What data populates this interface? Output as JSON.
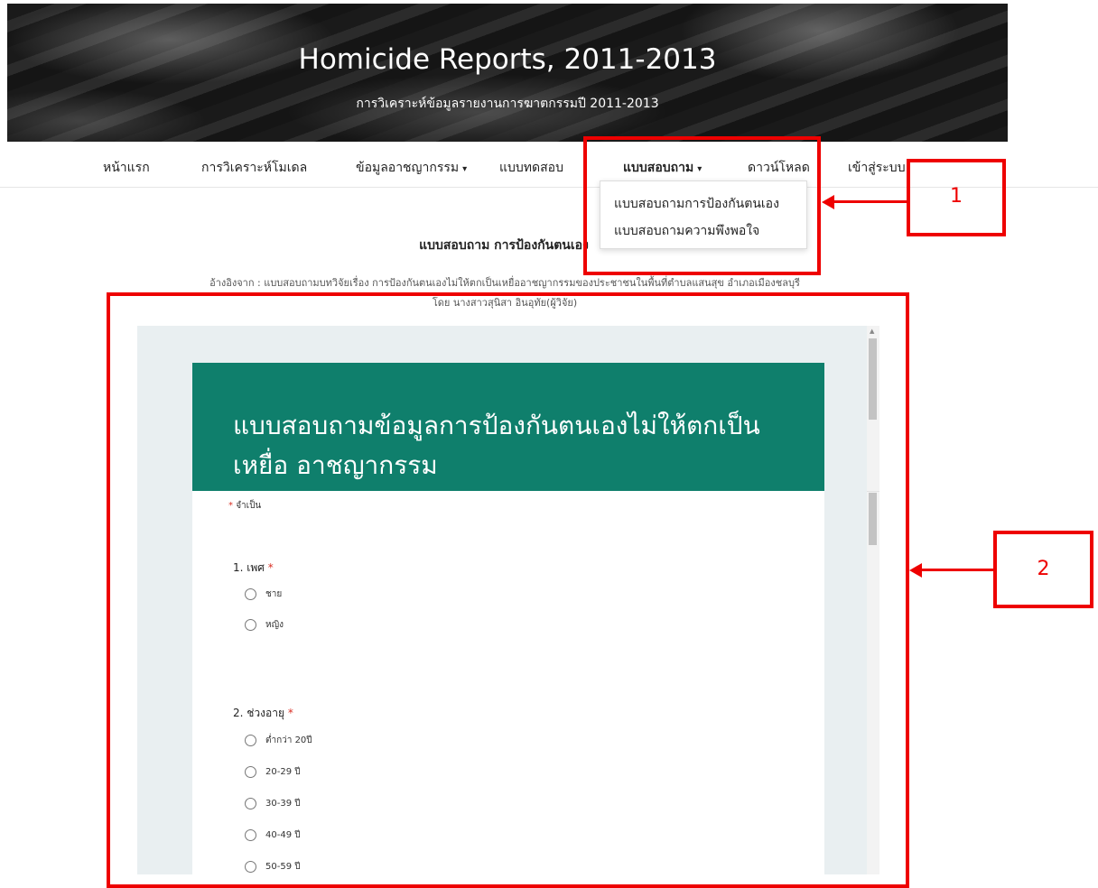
{
  "hero": {
    "title": "Homicide Reports, 2011-2013",
    "subtitle": "การวิเคราะห์ข้อมูลรายงานการฆาตกรรมปี 2011-2013"
  },
  "nav": {
    "items": [
      {
        "label": "หน้าแรก"
      },
      {
        "label": "การวิเคราะห์โมเดล"
      },
      {
        "label": "ข้อมูลอาชญากรรม",
        "caret": "▾"
      },
      {
        "label": "แบบทดสอบ"
      },
      {
        "label": "แบบสอบถาม",
        "caret": "▾"
      },
      {
        "label": "ดาวน์โหลด"
      },
      {
        "label": "เข้าสู่ระบบ"
      }
    ]
  },
  "dropdown": {
    "items": [
      {
        "label": "แบบสอบถามการป้องกันตนเอง"
      },
      {
        "label": "แบบสอบถามความพึงพอใจ"
      }
    ]
  },
  "annotations": {
    "label1": "1",
    "label2": "2",
    "color": "#ee0000"
  },
  "section": {
    "title": "แบบสอบถาม การป้องกันตนเอง",
    "source_line1": "อ้างอิงจาก : แบบสอบถามบทวิจัยเรื่อง การป้องกันตนเองไม่ให้ตกเป็นเหยื่ออาชญากรรมของประชาชนในพื้นที่ตำบลแสนสุข อำเภอเมืองชลบุรี",
    "source_line2": "โดย นางสาวสุนิสา อินอุทัย(ผู้วิจัย)"
  },
  "form": {
    "header_color": "#0f7f6c",
    "title": "แบบสอบถามข้อมูลการป้องกันตนเองไม่ให้ตกเป็นเหยื่อ อาชญากรรม",
    "required_star": "*",
    "required_note": "จำเป็น",
    "questions": [
      {
        "label": "1. เพศ",
        "star": "*",
        "options": [
          "ชาย",
          "หญิง"
        ]
      },
      {
        "label": "2. ช่วงอายุ",
        "star": "*",
        "options": [
          "ต่ำกว่า 20ปี",
          "20-29 ปี",
          "30-39 ปี",
          "40-49 ปี",
          "50-59 ปี"
        ]
      }
    ]
  }
}
